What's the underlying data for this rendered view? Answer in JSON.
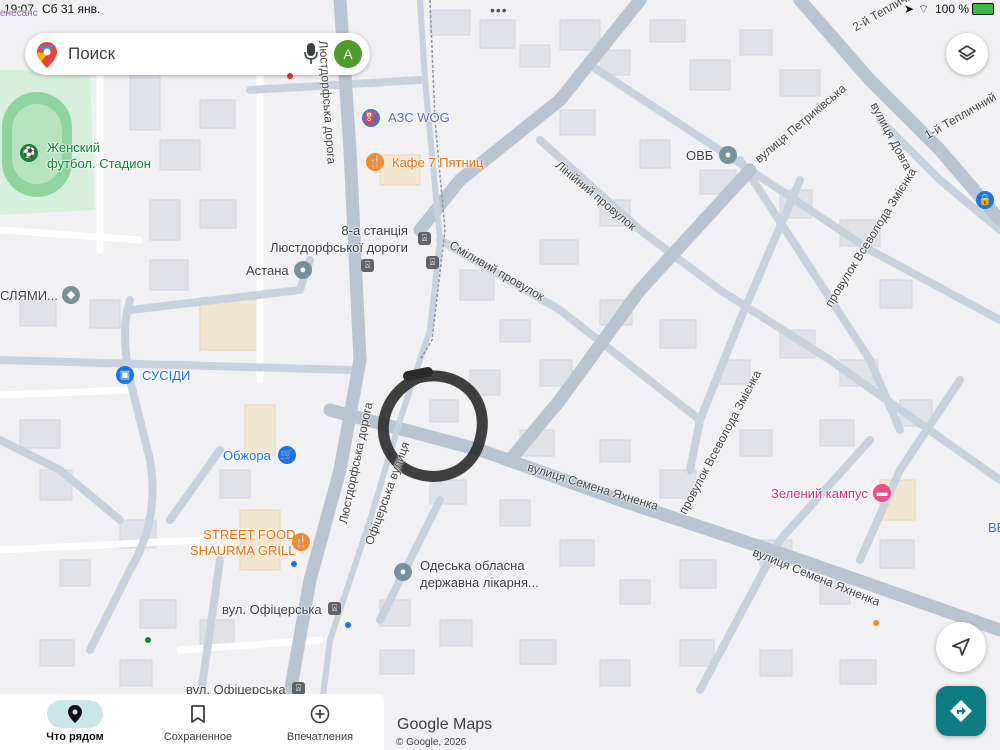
{
  "status_bar": {
    "time": "19:07",
    "date": "Сб 31 янв.",
    "battery": "100 %",
    "dots": "•••"
  },
  "search": {
    "placeholder": "Поиск",
    "avatar_letter": "A"
  },
  "map": {
    "corner_label": "енесанс",
    "streets": {
      "lustdorf_road_top": "Люстдорфська дорога",
      "lustdorf_road_left": "Люстдорфська дорога",
      "ofitserska": "Офіцерська вулиця",
      "yakhnenko_1": "вулиця Семена Яхненка",
      "yakhnenko_2": "вулиця Семена Яхненка",
      "liniinyi": "Лінійний провулок",
      "smilyvyi": "Сміливий провулок",
      "petrykivska": "вулиця Петриківська",
      "vsevoloda_zmienko_1": "провулок Всеволода Змієнка",
      "vsevoloda_zmienko_2": "провулок Всеволода Змієнка",
      "dovga": "вулиця Довга",
      "teplychnyi_1": "2-й Тепличн",
      "teplychnyi_2": "1-й Тепличний"
    },
    "pois": {
      "stadium": [
        "Женский",
        "футбол. Стадион"
      ],
      "azs": "АЗС WOG",
      "cafe": "Кафе 7 Пятниц",
      "station": [
        "8-а станція",
        "Люстдорфської дороги"
      ],
      "astana": "Астана",
      "slyami": "СЛЯМИ...",
      "susidy": "СУСІДИ",
      "obzhora": "Обжора",
      "street_food": [
        "STREET FOOD",
        "SHAURMA GRILL"
      ],
      "hospital": [
        "Одеська обласна",
        "державна лікарня..."
      ],
      "zelenyi": "Зелений кампус",
      "ovb": "ОВБ",
      "ofitserska_stop_1": "вул. Офіцерська",
      "ofitserska_stop_2": "вул. Офіцерська",
      "ve": "ВЕ"
    }
  },
  "bottom_nav": {
    "tabs": [
      {
        "label": "Что рядом",
        "icon": "location-pin-icon",
        "active": true
      },
      {
        "label": "Сохраненное",
        "icon": "bookmark-icon",
        "active": false
      },
      {
        "label": "Впечатления",
        "icon": "add-circle-icon",
        "active": false
      }
    ]
  },
  "google_logo": "Google Maps",
  "copyright": "© Google, 2026",
  "colors": {
    "accent": "#0d7c83",
    "road": "#c9d2dc",
    "road_major": "#b9c4d0",
    "park": "#cdebd4",
    "building": "#e3e3ea"
  }
}
